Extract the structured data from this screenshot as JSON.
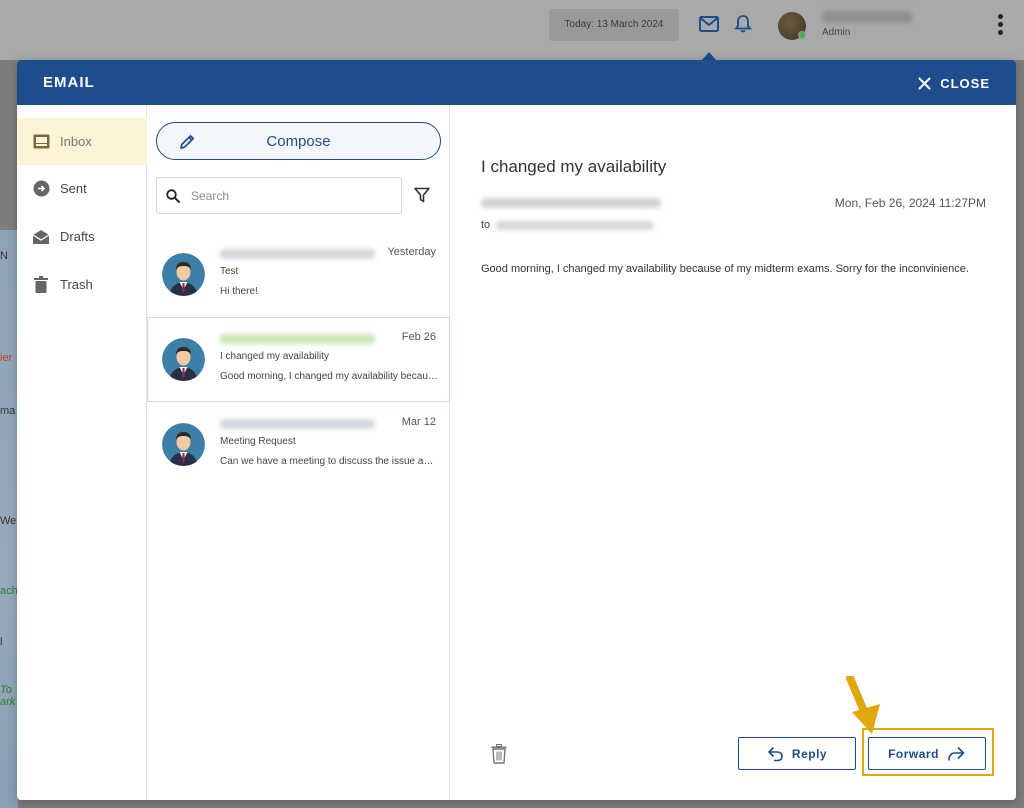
{
  "topbar": {
    "today_label": "Today: 13 March 2024",
    "user_role": "Admin"
  },
  "background_fragments": [
    "N",
    "ier",
    "ma",
    "We",
    "ach",
    "l",
    "To",
    "ark"
  ],
  "modal": {
    "title": "EMAIL",
    "close_label": "CLOSE"
  },
  "nav": {
    "items": [
      {
        "label": "Inbox",
        "icon": "inbox-icon",
        "active": true
      },
      {
        "label": "Sent",
        "icon": "sent-icon",
        "active": false
      },
      {
        "label": "Drafts",
        "icon": "drafts-icon",
        "active": false
      },
      {
        "label": "Trash",
        "icon": "trash-icon",
        "active": false
      }
    ]
  },
  "list": {
    "compose_label": "Compose",
    "search_placeholder": "Search",
    "messages": [
      {
        "date": "Yesterday",
        "subject": "Test",
        "preview": "Hi there!",
        "selected": false
      },
      {
        "date": "Feb 26",
        "subject": "I changed my availability",
        "preview": "Good morning, I changed my availability because of my midterm exams. Sorry for the inconvinience.",
        "selected": true
      },
      {
        "date": "Mar 12",
        "subject": "Meeting Request",
        "preview": "Can we have a meeting to discuss the issue about the schedule?",
        "selected": false
      }
    ]
  },
  "reader": {
    "subject": "I changed my availability",
    "date": "Mon, Feb 26, 2024 11:27PM",
    "to_label": "to",
    "body": "Good morning, I changed my availability because of my midterm exams. Sorry for the inconvinience.",
    "reply_label": "Reply",
    "forward_label": "Forward"
  },
  "colors": {
    "header": "#1e4c8c",
    "active_nav": "#fdf3d6",
    "highlight": "#e0a80e"
  }
}
